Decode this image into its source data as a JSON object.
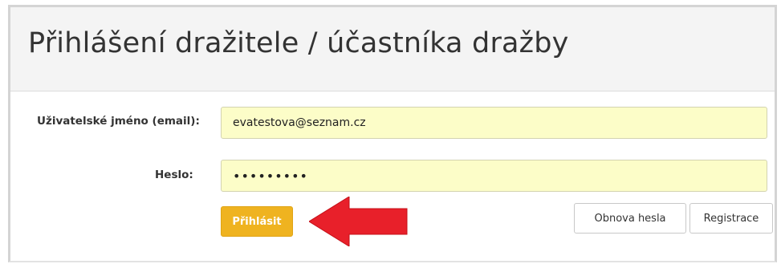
{
  "header": {
    "title": "Přihlášení dražitele / účastníka dražby"
  },
  "form": {
    "username_label": "Uživatelské jméno (email):",
    "username_value": "evatestova@seznam.cz",
    "password_label": "Heslo:",
    "password_value": "•••••••••"
  },
  "actions": {
    "login_label": "Přihlásit",
    "reset_password_label": "Obnova hesla",
    "register_label": "Registrace"
  },
  "colors": {
    "login_button": "#efb320",
    "input_background": "#fcfdc8",
    "annotation_arrow": "#e8202a"
  },
  "annotation": {
    "icon": "red-arrow-icon"
  }
}
